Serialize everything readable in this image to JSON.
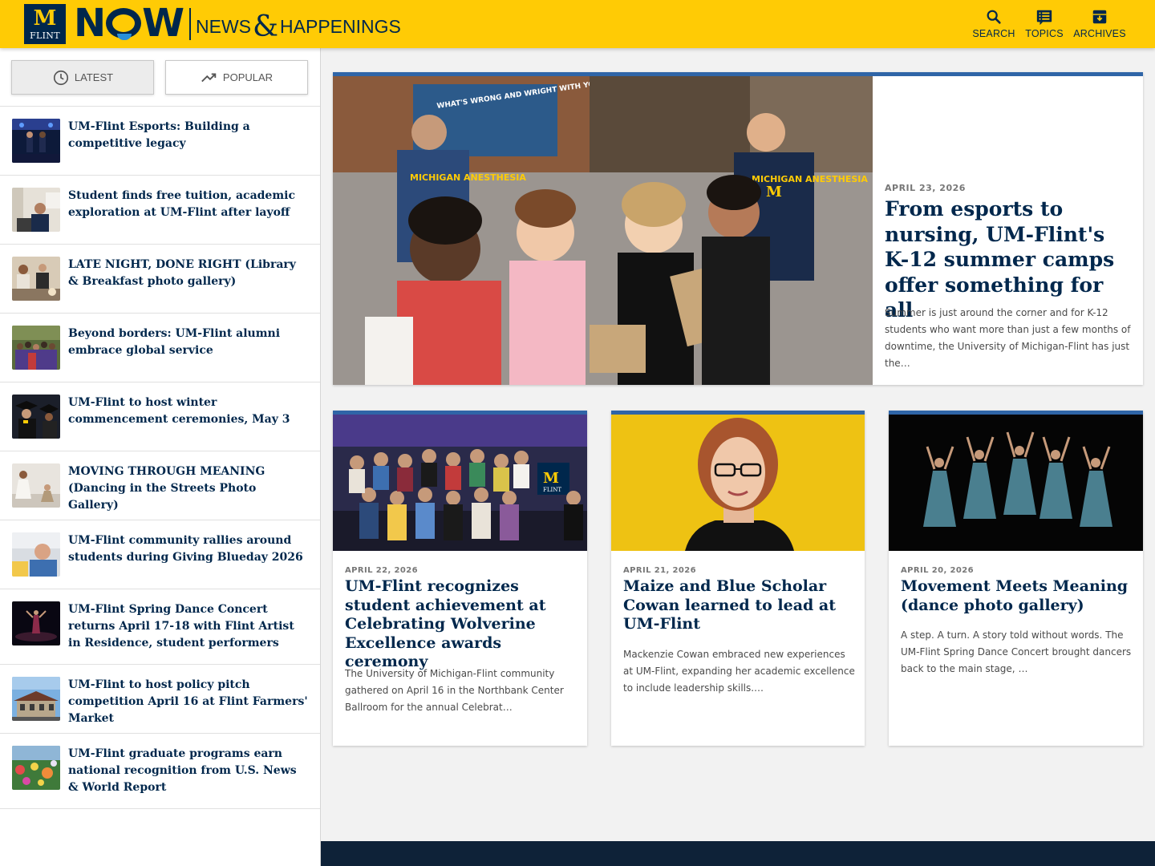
{
  "header": {
    "logo_m": "M",
    "logo_flint": "FLINT",
    "logo_now_n": "N",
    "logo_now_w": "W",
    "tagline_left": "NEWS",
    "tagline_amp": "&",
    "tagline_right": "HAPPENINGS",
    "nav": [
      {
        "label": "SEARCH",
        "icon": "search-icon"
      },
      {
        "label": "TOPICS",
        "icon": "topics-list-icon"
      },
      {
        "label": "ARCHIVES",
        "icon": "archive-box-icon"
      }
    ],
    "colors": {
      "maize": "#ffcb05",
      "blue": "#00274c",
      "accent": "#2f65a7"
    }
  },
  "sidebar": {
    "tabs": [
      {
        "label": "LATEST",
        "icon": "clock-icon",
        "selected": true
      },
      {
        "label": "POPULAR",
        "icon": "trending-up-icon",
        "selected": false
      }
    ],
    "items": [
      {
        "title": "UM-Flint Esports: Building a competitive legacy"
      },
      {
        "title": "Student finds free tuition, academic exploration at UM-Flint after layoff"
      },
      {
        "title": "LATE NIGHT, DONE RIGHT (Library & Breakfast photo gallery)"
      },
      {
        "title": "Beyond borders: UM-Flint alumni embrace global service"
      },
      {
        "title": "UM-Flint to host winter commencement ceremonies, May 3"
      },
      {
        "title": "MOVING THROUGH MEANING (Dancing in the Streets Photo Gallery)"
      },
      {
        "title": "UM-Flint community rallies around students during Giving Blueday 2026"
      },
      {
        "title": "UM-Flint Spring Dance Concert returns April 17-18 with Flint Artist in Residence, student performers"
      },
      {
        "title": "UM-Flint to host policy pitch competition April 16 at Flint Farmers' Market"
      },
      {
        "title": "UM-Flint graduate programs earn national recognition from U.S. News & World Report"
      }
    ]
  },
  "featured": {
    "date": "APRIL 23, 2026",
    "title": "From esports to nursing, UM-Flint's K-12 summer camps offer something for all",
    "summary": "Summer is just around the corner and for K-12 students who want more than just a few months of downtime, the University of Michigan-Flint has just the…",
    "photo_shirt_text_1": "WHAT'S WRONG AND WRIGHT WITH YOUR RESUME",
    "photo_shirt_text_2": "MICHIGAN ANESTHESIA",
    "photo_shirt_m": "M"
  },
  "cards": [
    {
      "date": "APRIL 22, 2026",
      "title": "UM-Flint recognizes student achievement at Celebrating Wolverine Excellence awards ceremony",
      "summary": "The University of Michigan-Flint community gathered on April 16 in the Northbank Center Ballroom for the annual Celebrat…",
      "banner_m": "M",
      "banner_flint": "FLINT"
    },
    {
      "date": "APRIL 21, 2026",
      "title": "Maize and Blue Scholar Cowan learned to lead at UM-Flint",
      "summary": "Mackenzie Cowan embraced new experiences at UM-Flint, expanding her academic excellence to include leadership skills.…"
    },
    {
      "date": "APRIL 20, 2026",
      "title": "Movement Meets Meaning (dance photo gallery)",
      "summary": "A step. A turn. A story told without words. The UM-Flint Spring Dance Concert brought dancers back to the main stage, …"
    }
  ]
}
